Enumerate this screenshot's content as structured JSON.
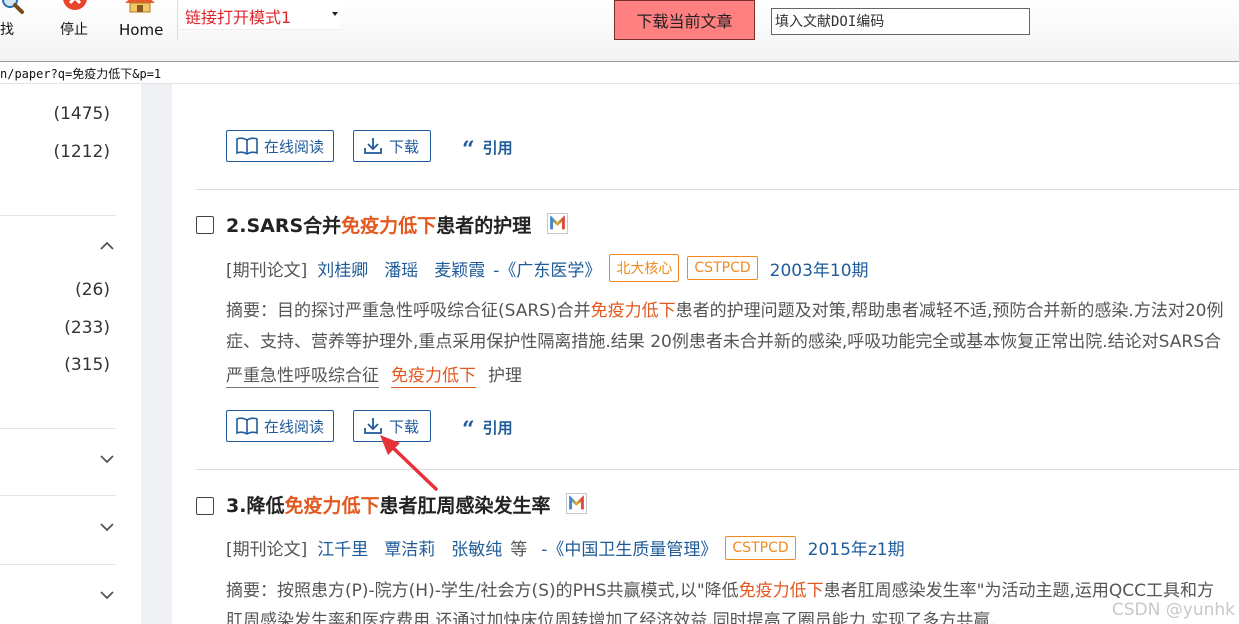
{
  "toolbar": {
    "search_label": "查找",
    "stop_label": "停止",
    "home_label": "Home",
    "mode_select": "链接打开模式1",
    "download_button": "下载当前文章",
    "doi_placeholder": "填入文献DOI编码"
  },
  "address": {
    "url": "n/paper?q=免疫力低下&p=1"
  },
  "sidebar": {
    "group1_counts": [
      "(1475)",
      "(1212)"
    ],
    "group2_counts": [
      "(26)",
      "(233)",
      "(315)"
    ]
  },
  "actions": {
    "read_online": "在线阅读",
    "download": "下载",
    "cite": "引用"
  },
  "results": [
    {
      "number": "2.",
      "title_pre": "SARS合并",
      "title_hl": "免疫力低下",
      "title_post": "患者的护理",
      "type": "[期刊论文]",
      "authors": [
        "刘桂卿",
        "潘瑶",
        "麦颖霞"
      ],
      "source": "-《广东医学》",
      "tags": [
        "北大核心",
        "CSTPCD"
      ],
      "issue": "2003年10期",
      "abstract_line1_pre": "摘要：目的探讨严重急性呼吸综合征(SARS)合并",
      "abstract_line1_hl": "免疫力低下",
      "abstract_line1_post": "患者的护理问题及对策,帮助患者减轻不适,预防合并新的感染.方法对20例",
      "abstract_line2": "症、支持、营养等护理外,重点采用保护性隔离措施.结果 20例患者未合并新的感染,呼吸功能完全或基本恢复正常出院.结论对SARS合",
      "keywords": [
        {
          "text": "严重急性呼吸综合征",
          "highlight": false
        },
        {
          "text": "免疫力低下",
          "highlight": true
        },
        {
          "text": "护理",
          "highlight": false
        }
      ]
    },
    {
      "number": "3.",
      "title_pre": "降低",
      "title_hl": "免疫力低下",
      "title_post": "患者肛周感染发生率",
      "type": "[期刊论文]",
      "authors": [
        "江千里",
        "覃洁莉",
        "张敏纯"
      ],
      "authors_suffix": "等",
      "source": "-《中国卫生质量管理》",
      "tags": [
        "CSTPCD"
      ],
      "issue": "2015年z1期",
      "abstract_line1_pre": "摘要：按照患方(P)-院方(H)-学生/社会方(S)的PHS共赢模式,以\"降低",
      "abstract_line1_hl": "免疫力低下",
      "abstract_line1_post": "患者肛周感染发生率\"为活动主题,运用QCC工具和方",
      "abstract_line2": "肛周感染发生率和医疗费用,还通过加快床位周转增加了经济效益,同时提高了圈员能力,实现了多方共赢."
    }
  ],
  "watermark": "CSDN @yunhk",
  "colors": {
    "accent_blue": "#1f5c99",
    "highlight_orange": "#e2581f",
    "tag_orange": "#f08a1e",
    "download_button_bg": "#ff8080",
    "annotation_arrow": "#e8323a"
  }
}
